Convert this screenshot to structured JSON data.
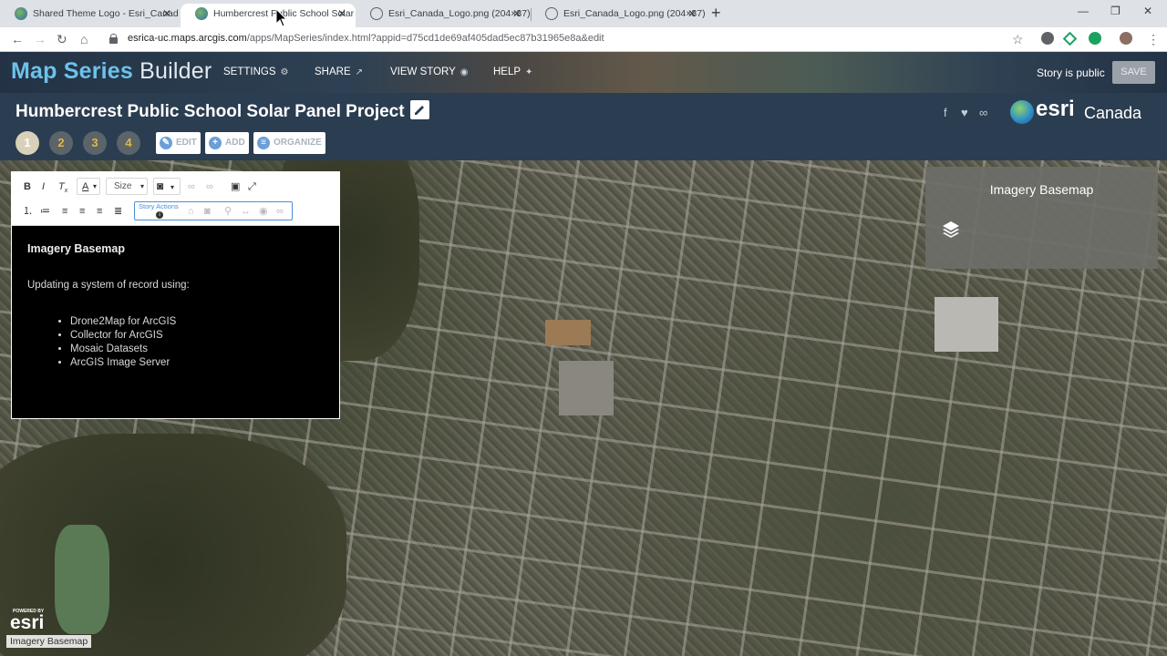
{
  "browser": {
    "tabs": [
      {
        "title": "Shared Theme Logo - Esri_Canad",
        "active": false
      },
      {
        "title": "Humbercrest Public School Solar",
        "active": true
      },
      {
        "title": "Esri_Canada_Logo.png (204×37)",
        "active": false
      },
      {
        "title": "Esri_Canada_Logo.png (204×37)",
        "active": false
      }
    ],
    "url_host": "esrica-uc.maps.arcgis.com",
    "url_path": "/apps/MapSeries/index.html?appid=d75cd1de69af405dad5ec87b31965e8a&edit"
  },
  "header": {
    "title_bold": "Map Series",
    "title_light": "Builder",
    "menu": [
      {
        "label": "SETTINGS",
        "icon": "gear-icon"
      },
      {
        "label": "SHARE",
        "icon": "share-icon"
      },
      {
        "label": "VIEW STORY",
        "icon": "eye-icon"
      },
      {
        "label": "HELP",
        "icon": "help-icon"
      }
    ],
    "public_status": "Story is public",
    "save_label": "SAVE"
  },
  "story": {
    "title": "Humbercrest Public School Solar Panel Project",
    "brand": {
      "word": "esri",
      "region": "Canada"
    },
    "entries": [
      "1",
      "2",
      "3",
      "4"
    ],
    "actions": [
      {
        "label": "EDIT",
        "icon": "pencil-icon"
      },
      {
        "label": "ADD",
        "icon": "plus-icon"
      },
      {
        "label": "ORGANIZE",
        "icon": "list-icon"
      }
    ]
  },
  "editor": {
    "size_label": "Size",
    "story_actions_label": "Story Actions",
    "heading": "Imagery Basemap",
    "intro": "Updating a system of record using:",
    "list": [
      "Drone2Map for ArcGIS",
      "Collector for ArcGIS",
      "Mosaic Datasets",
      "ArcGIS Image Server"
    ]
  },
  "legend": {
    "title": "Imagery Basemap"
  },
  "map": {
    "powered_by": "POWERED BY",
    "powered_logo": "esri",
    "attribution": "Imagery Basemap"
  },
  "colors": {
    "accent": "#6cc2ea",
    "header_bg": "#2b3d50",
    "entry_number": "#e2b647"
  }
}
